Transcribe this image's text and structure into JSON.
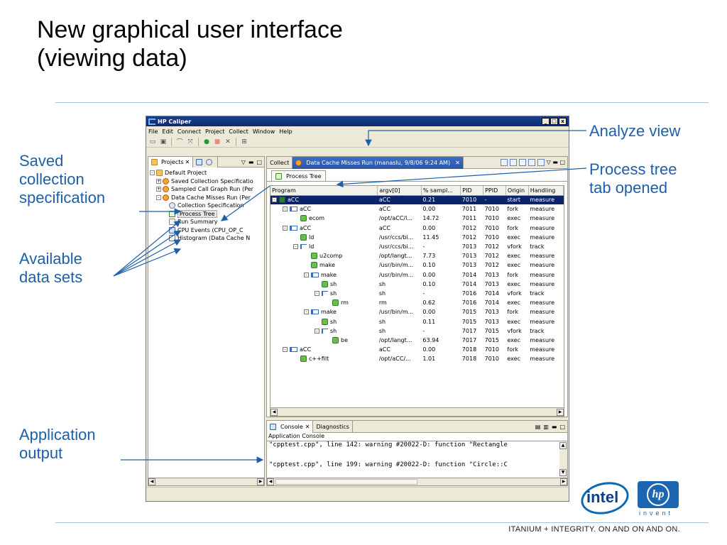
{
  "slide": {
    "title_line1": "New graphical user interface",
    "title_line2": "(viewing data)",
    "tagline": "ITANIUM + INTEGRITY. ON AND ON AND ON.",
    "callouts": {
      "saved_spec": [
        "Saved",
        "collection",
        "specification"
      ],
      "available": [
        "Available",
        "data sets"
      ],
      "app_output": [
        "Application",
        "output"
      ],
      "analyze_view": "Analyze view",
      "process_tree": [
        "Process tree",
        "tab opened"
      ]
    },
    "logos": {
      "intel": "intel",
      "hp": "hp",
      "hp_invent": "invent"
    }
  },
  "window": {
    "title": "HP Caliper",
    "controls": [
      "_",
      "□",
      "x"
    ],
    "menu": [
      "File",
      "Edit",
      "Connect",
      "Project",
      "Collect",
      "Window",
      "Help"
    ]
  },
  "projects_panel": {
    "tab_label": "Projects",
    "tab2_icon": "data-icon",
    "tree": [
      {
        "label": "Default Project",
        "level": 0,
        "toggle": "-",
        "icon": "folder"
      },
      {
        "label": "Saved Collection Specificatio",
        "level": 1,
        "toggle": "+",
        "icon": "run"
      },
      {
        "label": "Sampled Call Graph Run (Per",
        "level": 1,
        "toggle": "+",
        "icon": "run"
      },
      {
        "label": "Data Cache Misses Run (Per",
        "level": 1,
        "toggle": "-",
        "icon": "run"
      },
      {
        "label": "Collection Specification",
        "level": 2,
        "toggle": "",
        "icon": "spec"
      },
      {
        "label": "Process Tree",
        "level": 2,
        "toggle": "",
        "icon": "tree-i",
        "highlight": true
      },
      {
        "label": "Run Summary",
        "level": 2,
        "toggle": "",
        "icon": "doc"
      },
      {
        "label": "CPU Events (CPU_OP_C",
        "level": 2,
        "toggle": "",
        "icon": "cpu"
      },
      {
        "label": "Histogram (Data Cache N",
        "level": 2,
        "toggle": "",
        "icon": "hist"
      }
    ]
  },
  "editor": {
    "tab_collect": "Collect",
    "tab_active": "Data Cache Misses Run (manaslu, 9/8/06 9:24 AM)",
    "subtab": "Process Tree",
    "columns": [
      "Program",
      "argv[0]",
      "% sampl...",
      "PID",
      "PPID",
      "Origin",
      "Handling"
    ],
    "rows": [
      {
        "program": "aCC",
        "indent": 0,
        "toggle": "-",
        "icon": "start",
        "argv": "aCC",
        "pct": "0.21",
        "pid": "7010",
        "ppid": "-",
        "origin": "start",
        "handling": "measure",
        "selected": true
      },
      {
        "program": "aCC",
        "indent": 1,
        "toggle": "-",
        "icon": "fork",
        "argv": "aCC",
        "pct": "0.00",
        "pid": "7011",
        "ppid": "7010",
        "origin": "fork",
        "handling": "measure"
      },
      {
        "program": "ecom",
        "indent": 2,
        "toggle": "",
        "icon": "exec",
        "argv": "/opt/aCC/l...",
        "pct": "14.72",
        "pid": "7011",
        "ppid": "7010",
        "origin": "exec",
        "handling": "measure"
      },
      {
        "program": "aCC",
        "indent": 1,
        "toggle": "-",
        "icon": "fork",
        "argv": "aCC",
        "pct": "0.00",
        "pid": "7012",
        "ppid": "7010",
        "origin": "fork",
        "handling": "measure"
      },
      {
        "program": "ld",
        "indent": 2,
        "toggle": "",
        "icon": "exec",
        "argv": "/usr/ccs/bi...",
        "pct": "11.45",
        "pid": "7012",
        "ppid": "7010",
        "origin": "exec",
        "handling": "measure"
      },
      {
        "program": "ld",
        "indent": 2,
        "toggle": "-",
        "icon": "vfork",
        "argv": "/usr/ccs/bi...",
        "pct": "-",
        "pid": "7013",
        "ppid": "7012",
        "origin": "vfork",
        "handling": "track"
      },
      {
        "program": "u2comp",
        "indent": 3,
        "toggle": "",
        "icon": "exec",
        "argv": "/opt/langt...",
        "pct": "7.73",
        "pid": "7013",
        "ppid": "7012",
        "origin": "exec",
        "handling": "measure"
      },
      {
        "program": "make",
        "indent": 3,
        "toggle": "",
        "icon": "exec",
        "argv": "/usr/bin/m...",
        "pct": "0.10",
        "pid": "7013",
        "ppid": "7012",
        "origin": "exec",
        "handling": "measure"
      },
      {
        "program": "make",
        "indent": 3,
        "toggle": "-",
        "icon": "fork",
        "argv": "/usr/bin/m...",
        "pct": "0.00",
        "pid": "7014",
        "ppid": "7013",
        "origin": "fork",
        "handling": "measure"
      },
      {
        "program": "sh",
        "indent": 4,
        "toggle": "",
        "icon": "exec",
        "argv": "sh",
        "pct": "0.10",
        "pid": "7014",
        "ppid": "7013",
        "origin": "exec",
        "handling": "measure"
      },
      {
        "program": "sh",
        "indent": 4,
        "toggle": "-",
        "icon": "vfork",
        "argv": "sh",
        "pct": "-",
        "pid": "7016",
        "ppid": "7014",
        "origin": "vfork",
        "handling": "track"
      },
      {
        "program": "rm",
        "indent": 5,
        "toggle": "",
        "icon": "exec",
        "argv": "rm",
        "pct": "0.62",
        "pid": "7016",
        "ppid": "7014",
        "origin": "exec",
        "handling": "measure"
      },
      {
        "program": "make",
        "indent": 3,
        "toggle": "-",
        "icon": "fork",
        "argv": "/usr/bin/m...",
        "pct": "0.00",
        "pid": "7015",
        "ppid": "7013",
        "origin": "fork",
        "handling": "measure"
      },
      {
        "program": "sh",
        "indent": 4,
        "toggle": "",
        "icon": "exec",
        "argv": "sh",
        "pct": "0.11",
        "pid": "7015",
        "ppid": "7013",
        "origin": "exec",
        "handling": "measure"
      },
      {
        "program": "sh",
        "indent": 4,
        "toggle": "-",
        "icon": "vfork",
        "argv": "sh",
        "pct": "-",
        "pid": "7017",
        "ppid": "7015",
        "origin": "vfork",
        "handling": "track"
      },
      {
        "program": "be",
        "indent": 5,
        "toggle": "",
        "icon": "exec",
        "argv": "/opt/langt...",
        "pct": "63.94",
        "pid": "7017",
        "ppid": "7015",
        "origin": "exec",
        "handling": "measure"
      },
      {
        "program": "aCC",
        "indent": 1,
        "toggle": "-",
        "icon": "fork",
        "argv": "aCC",
        "pct": "0.00",
        "pid": "7018",
        "ppid": "7010",
        "origin": "fork",
        "handling": "measure"
      },
      {
        "program": "c++filt",
        "indent": 2,
        "toggle": "",
        "icon": "exec",
        "argv": "/opt/aCC/...",
        "pct": "1.01",
        "pid": "7018",
        "ppid": "7010",
        "origin": "exec",
        "handling": "measure"
      }
    ]
  },
  "console": {
    "tab_console": "Console",
    "tab_diagnostics": "Diagnostics",
    "label": "Application Console",
    "lines": [
      "\"cpptest.cpp\", line 142: warning #20022-D: function \"Rectangle",
      "\"cpptest.cpp\", line 199: warning #20022-D: function \"Circle::C"
    ]
  }
}
